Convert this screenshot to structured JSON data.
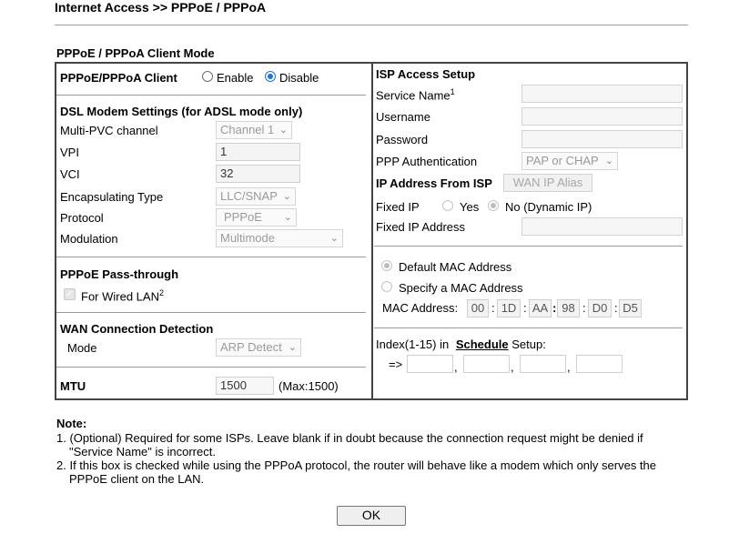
{
  "breadcrumb": "Internet Access >> PPPoE / PPPoA",
  "section_title": "PPPoE / PPPoA Client Mode",
  "client": {
    "label": "PPPoE/PPPoA Client",
    "enable_label": "Enable",
    "disable_label": "Disable",
    "selected": "Disable"
  },
  "dsl": {
    "title": "DSL Modem Settings (for ADSL mode only)",
    "multi_pvc_label": "Multi-PVC channel",
    "multi_pvc_value": "Channel 1",
    "vpi_label": "VPI",
    "vpi_value": "1",
    "vci_label": "VCI",
    "vci_value": "32",
    "encap_label": "Encapsulating Type",
    "encap_value": "LLC/SNAP",
    "protocol_label": "Protocol",
    "protocol_value": "PPPoE",
    "modulation_label": "Modulation",
    "modulation_value": "Multimode"
  },
  "passthrough": {
    "title": "PPPoE Pass-through",
    "wired_label": "For Wired LAN",
    "wired_sup": "2",
    "checked": true
  },
  "wan_detect": {
    "title": "WAN Connection Detection",
    "mode_label": "Mode",
    "mode_value": "ARP Detect"
  },
  "mtu": {
    "label": "MTU",
    "value": "1500",
    "hint": "(Max:1500)"
  },
  "isp": {
    "title": "ISP Access Setup",
    "service_name_label": "Service Name",
    "service_name_sup": "1",
    "service_name_value": "",
    "username_label": "Username",
    "username_value": "",
    "password_label": "Password",
    "password_value": "",
    "ppp_auth_label": "PPP Authentication",
    "ppp_auth_value": "PAP or CHAP"
  },
  "ip_from_isp": {
    "title": "IP Address From ISP",
    "wan_alias_button": "WAN IP Alias",
    "fixed_ip_label": "Fixed IP",
    "yes_label": "Yes",
    "no_label": "No (Dynamic IP)",
    "selected": "No",
    "fixed_ip_address_label": "Fixed IP Address",
    "fixed_ip_address_value": ""
  },
  "mac": {
    "default_label": "Default MAC Address",
    "specify_label": "Specify a MAC Address",
    "selected": "Default",
    "address_label": "MAC Address:",
    "octets": [
      "00",
      "1D",
      "AA",
      "98",
      "D0",
      "D5"
    ]
  },
  "schedule": {
    "prefix": "Index(1-15) in",
    "link": "Schedule",
    "suffix": "Setup:",
    "arrow": "=>",
    "values": [
      "",
      "",
      "",
      ""
    ]
  },
  "notes": {
    "title": "Note:",
    "items": [
      "1. (Optional) Required for some ISPs. Leave blank if in doubt because the connection request might be denied if",
      "\"Service Name\" is incorrect.",
      "2. If this box is checked while using the PPPoA protocol, the router will behave like a modem which only serves the",
      "PPPoE client on the LAN."
    ]
  },
  "ok_button": "OK"
}
